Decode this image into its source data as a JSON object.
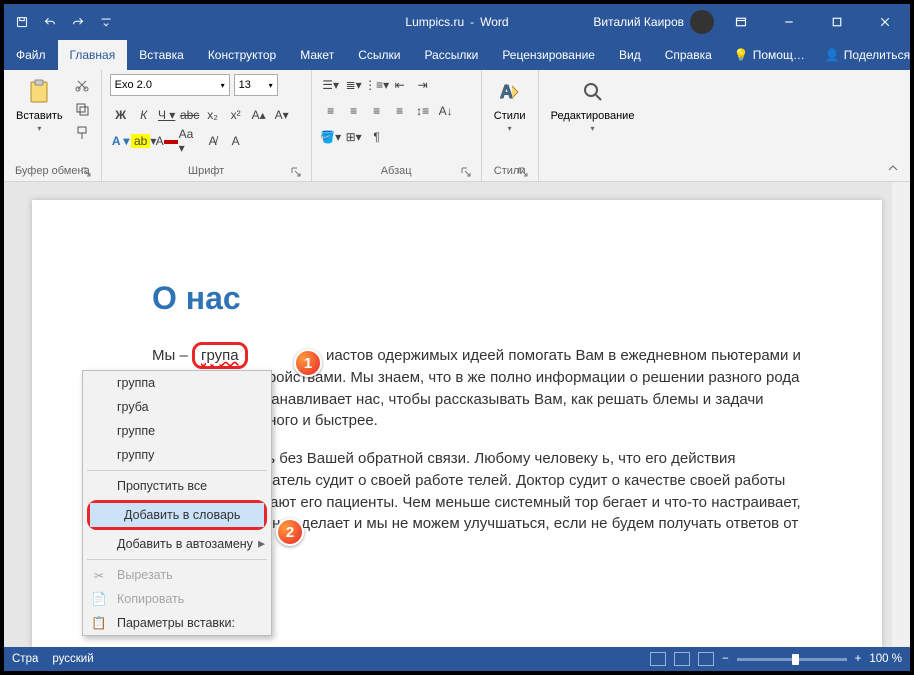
{
  "title": {
    "doc": "Lumpics.ru",
    "app": "Word",
    "user": "Виталий Каиров"
  },
  "tabs": {
    "file": "Файл",
    "home": "Главная",
    "insert": "Вставка",
    "design": "Конструктор",
    "layout": "Макет",
    "references": "Ссылки",
    "mailings": "Рассылки",
    "review": "Рецензирование",
    "view": "Вид",
    "help": "Справка",
    "assistant": "Помощ…",
    "share": "Поделиться"
  },
  "ribbon": {
    "clipboard": {
      "paste": "Вставить",
      "group": "Буфер обмена"
    },
    "font": {
      "name": "Exo 2.0",
      "size": "13",
      "group": "Шрифт"
    },
    "paragraph": {
      "group": "Абзац"
    },
    "styles": {
      "btn": "Стили",
      "group": "Стили"
    },
    "editing": {
      "btn": "Редактирование"
    }
  },
  "document": {
    "heading": "О нас",
    "p1_pre": "Мы – ",
    "misspelled": "група",
    "p1_post": "иастов одержимых идеей помогать Вам в ежедневном пьютерами и мобильными устройствами. Мы знаем, что в же полно информации о решении разного рода проблем с не останавливает нас, чтобы рассказывать Вам, как решать блемы и задачи более качественного и быстрее.",
    "p2": "ожем это сделать без Вашей обратной связи. Любому человеку ь, что его действия правильные. Писатель судит о своей работе телей. Доктор судит о качестве своей работы по тому, как зливают его пациенты. Чем меньше системный тор бегает и что-то настраивает, тем он качественнее делает и мы не можем улучшаться, если не будем получать ответов от"
  },
  "callouts": {
    "one": "1",
    "two": "2"
  },
  "context_menu": {
    "suggestions": [
      "группа",
      "груба",
      "группе",
      "группу"
    ],
    "ignore_all": "Пропустить все",
    "add_dict": "Добавить в словарь",
    "add_autocorrect": "Добавить в автозамену",
    "cut": "Вырезать",
    "copy": "Копировать",
    "paste_options": "Параметры вставки:"
  },
  "statusbar": {
    "page": "Стра",
    "language": "русский",
    "zoom": "100 %"
  }
}
